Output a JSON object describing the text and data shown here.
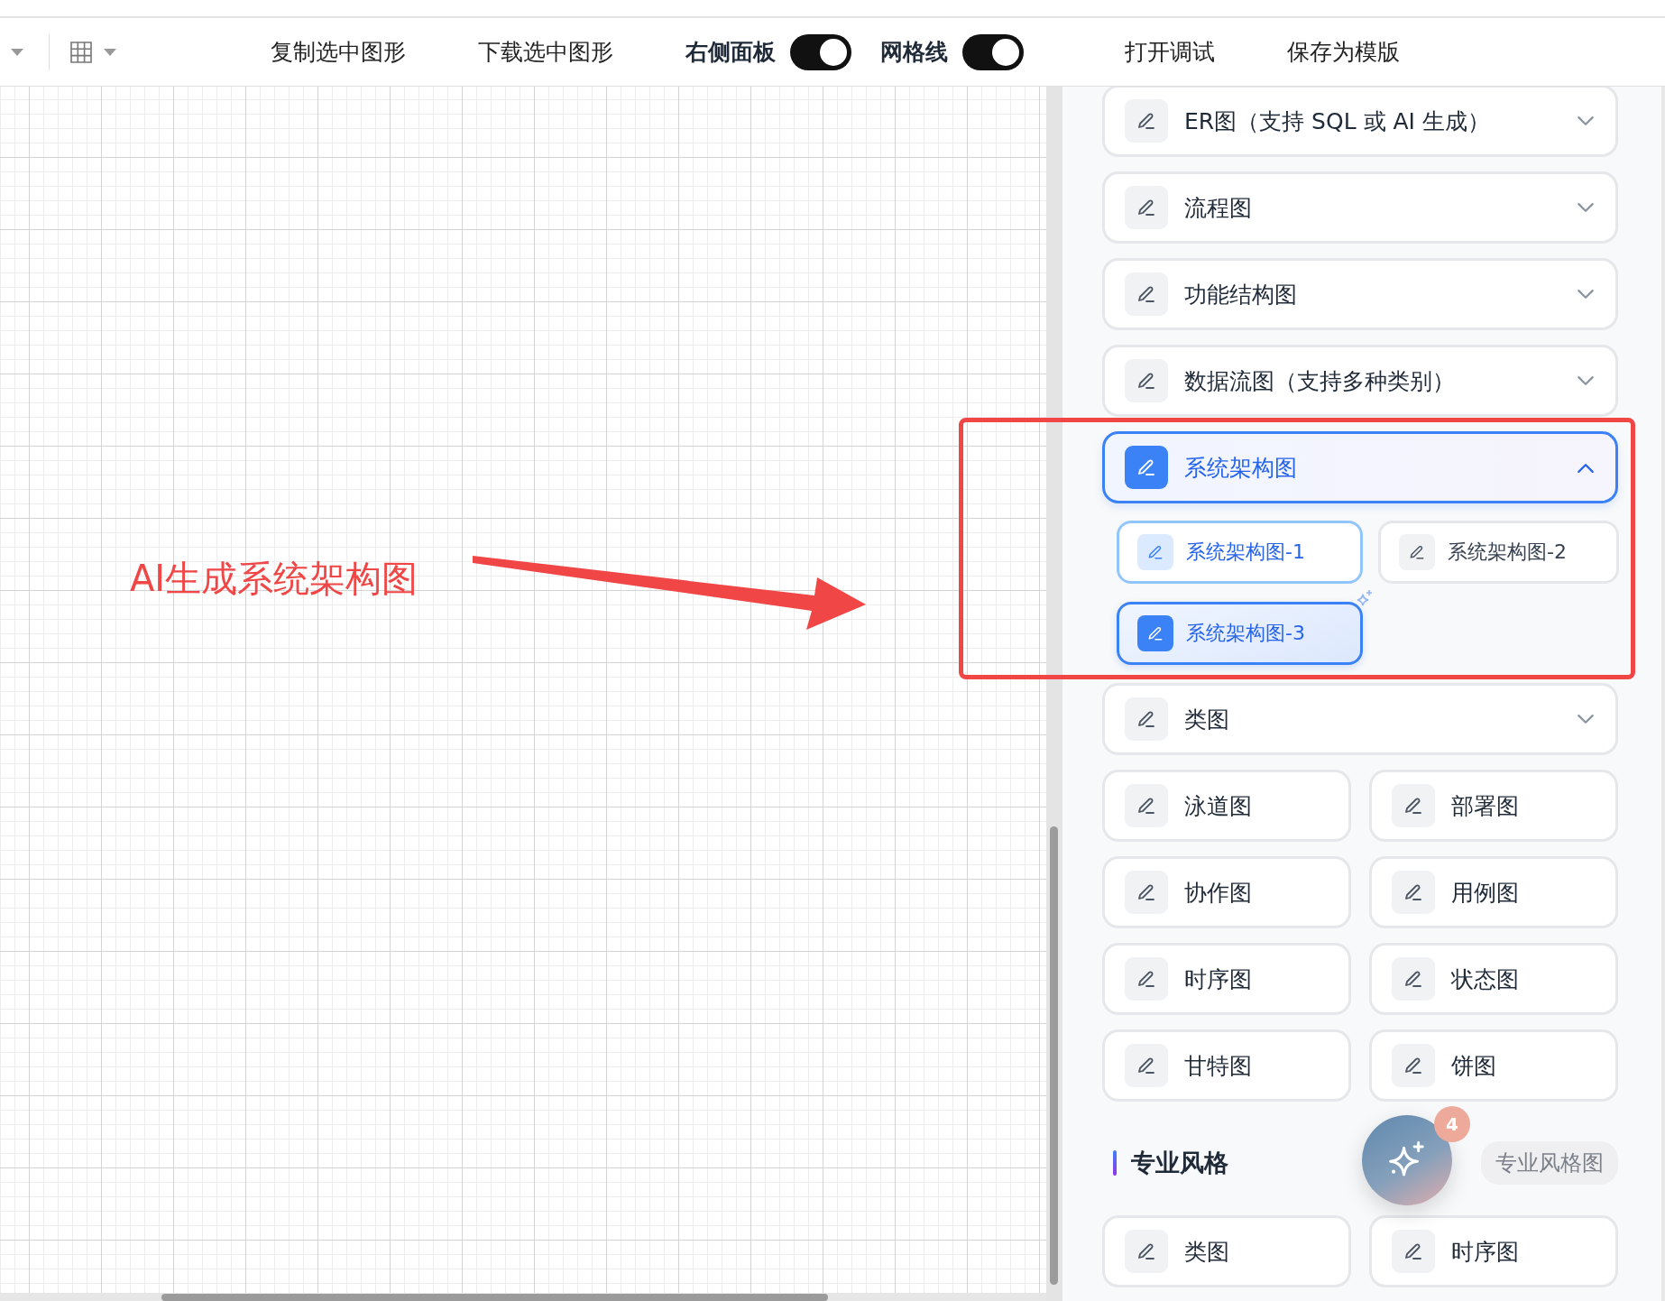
{
  "toolbar": {
    "actions": [
      {
        "kind": "button",
        "label": "复制选中图形"
      },
      {
        "kind": "button",
        "label": "下载选中图形"
      },
      {
        "kind": "toggle",
        "label": "右侧面板",
        "on": true
      },
      {
        "kind": "toggle",
        "label": "网格线",
        "on": true
      },
      {
        "kind": "button",
        "label": "打开调试"
      },
      {
        "kind": "button",
        "label": "保存为模版"
      }
    ]
  },
  "panel": {
    "items": [
      {
        "kind": "accordion",
        "label": "ER图（支持 SQL 或 AI 生成）",
        "expanded": false
      },
      {
        "kind": "accordion",
        "label": "流程图",
        "expanded": false
      },
      {
        "kind": "accordion",
        "label": "功能结构图",
        "expanded": false
      },
      {
        "kind": "accordion",
        "label": "数据流图（支持多种类别）",
        "expanded": false
      },
      {
        "kind": "accordion",
        "label": "系统架构图",
        "expanded": true,
        "children": [
          {
            "label": "系统架构图-1",
            "selected": false,
            "highlighted": true,
            "sparkle": false
          },
          {
            "label": "系统架构图-2",
            "selected": false,
            "highlighted": false,
            "sparkle": false
          },
          {
            "label": "系统架构图-3",
            "selected": true,
            "highlighted": false,
            "sparkle": true
          }
        ]
      },
      {
        "kind": "accordion",
        "label": "类图",
        "expanded": false
      },
      {
        "kind": "pair",
        "items": [
          {
            "label": "泳道图"
          },
          {
            "label": "部署图"
          }
        ]
      },
      {
        "kind": "pair",
        "items": [
          {
            "label": "协作图"
          },
          {
            "label": "用例图"
          }
        ]
      },
      {
        "kind": "pair",
        "items": [
          {
            "label": "时序图"
          },
          {
            "label": "状态图"
          }
        ]
      },
      {
        "kind": "pair",
        "items": [
          {
            "label": "甘特图"
          },
          {
            "label": "饼图"
          }
        ]
      },
      {
        "kind": "section",
        "title": "专业风格",
        "action": "专业风格图"
      },
      {
        "kind": "pair",
        "items": [
          {
            "label": "类图"
          },
          {
            "label": "时序图"
          }
        ]
      }
    ]
  },
  "assistant_button": {
    "badge": "4"
  },
  "annotation": {
    "text": "AI生成系统架构图"
  }
}
